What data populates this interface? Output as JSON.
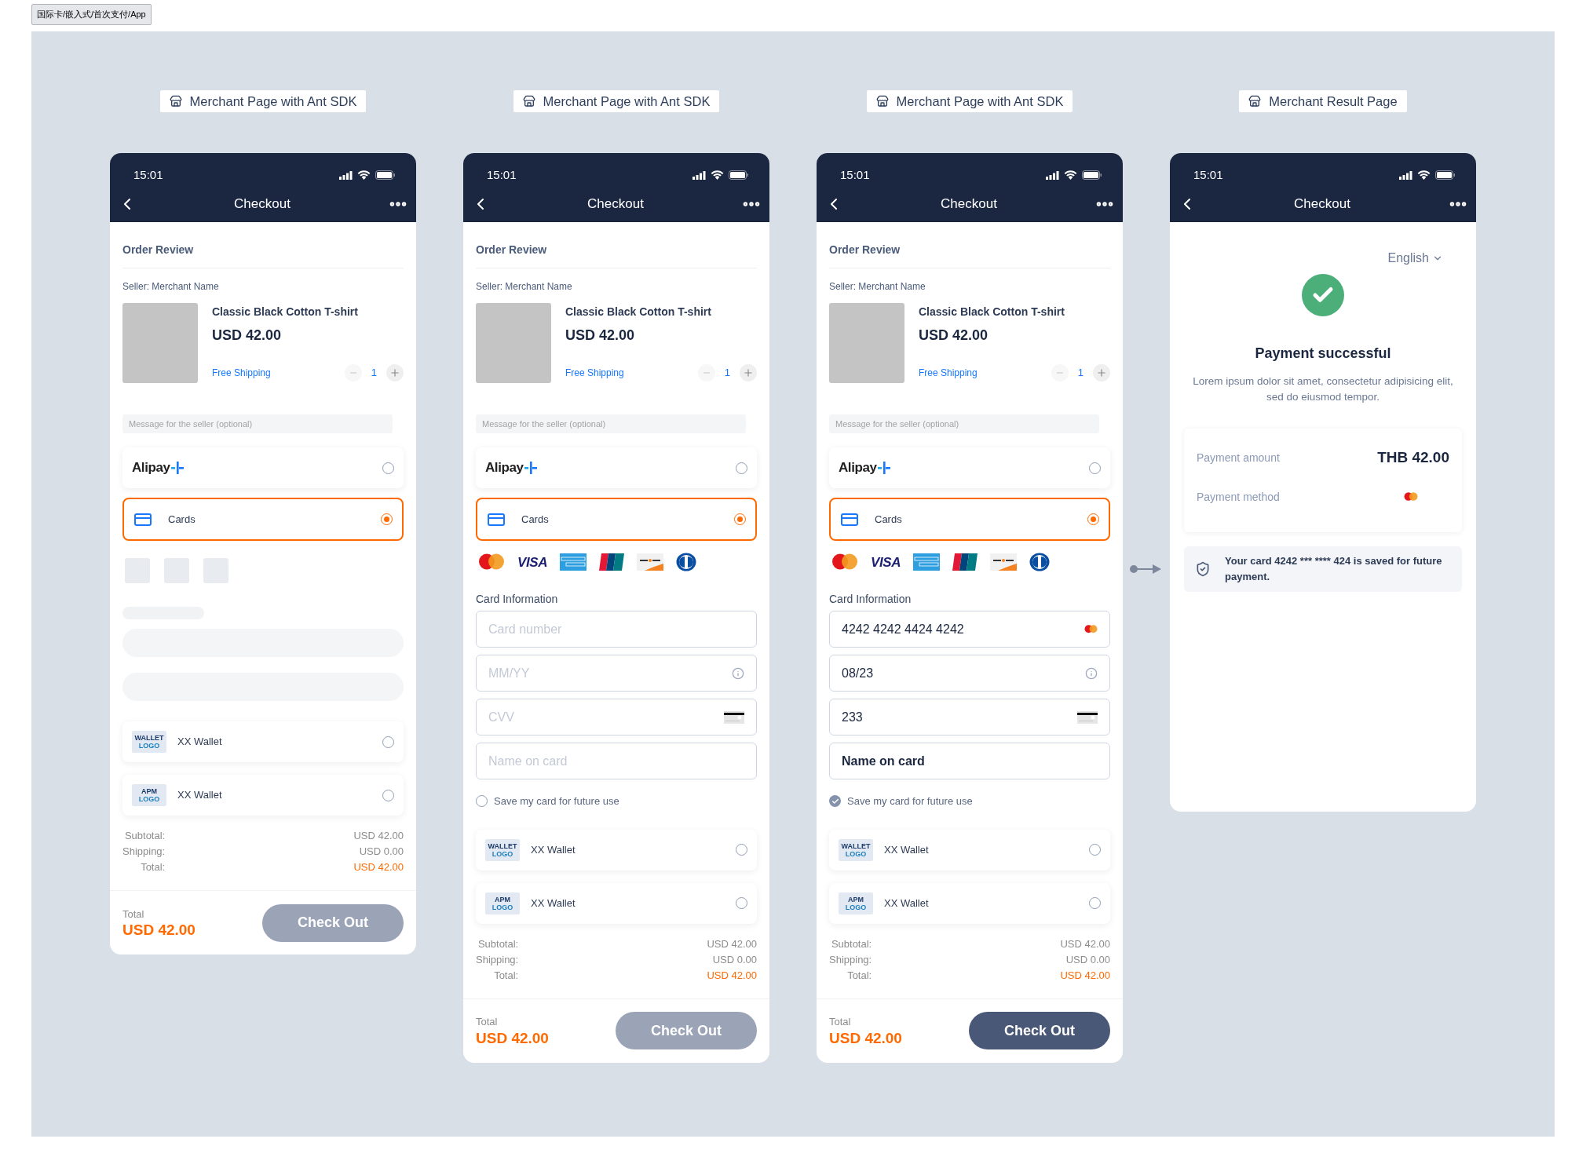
{
  "breadcrumb": "国际卡/嵌入式/首次支付/App",
  "screens": [
    {
      "kind": "checkout",
      "caption": "Merchant Page with Ant SDK",
      "time": "15:01",
      "nav_title": "Checkout",
      "section_title": "Order Review",
      "seller": "Seller: Merchant Name",
      "product": {
        "title": "Classic Black Cotton T-shirt",
        "price": "USD 42.00",
        "shipping": "Free Shipping",
        "quantity": "1"
      },
      "message_placeholder": "Message for the seller (optional)",
      "methods": [
        {
          "kind": "alipay",
          "label": "Alipay",
          "selected": false
        },
        {
          "kind": "cards",
          "label": "Cards",
          "selected": true
        }
      ],
      "card_section": {
        "kind": "skeleton"
      },
      "wallets": [
        {
          "logo_lines": [
            "WALLET",
            "LOGO"
          ],
          "label": "XX Wallet",
          "selected": false
        },
        {
          "logo_lines": [
            "APM",
            "LOGO"
          ],
          "label": "XX Wallet",
          "selected": false
        }
      ],
      "summary": [
        {
          "label": "Subtotal:",
          "value": "USD 42.00",
          "highlight": false
        },
        {
          "label": "Shipping:",
          "value": "USD 0.00",
          "highlight": false
        },
        {
          "label": "Total:",
          "value": "USD 42.00",
          "highlight": true
        }
      ],
      "footer": {
        "label": "Total",
        "amount": "USD 42.00",
        "button": {
          "label": "Check Out",
          "disabled": true
        }
      }
    },
    {
      "kind": "checkout",
      "caption": "Merchant Page with Ant SDK",
      "time": "15:01",
      "nav_title": "Checkout",
      "section_title": "Order Review",
      "seller": "Seller: Merchant Name",
      "product": {
        "title": "Classic Black Cotton T-shirt",
        "price": "USD 42.00",
        "shipping": "Free Shipping",
        "quantity": "1"
      },
      "message_placeholder": "Message for the seller (optional)",
      "methods": [
        {
          "kind": "alipay",
          "label": "Alipay",
          "selected": false
        },
        {
          "kind": "cards",
          "label": "Cards",
          "selected": true
        }
      ],
      "card_section": {
        "kind": "form",
        "brands": [
          {
            "kind": "mastercard"
          },
          {
            "kind": "visa",
            "label": "VISA"
          },
          {
            "kind": "amex"
          },
          {
            "kind": "unionpay"
          },
          {
            "kind": "discover"
          },
          {
            "kind": "diners"
          }
        ],
        "label": "Card Information",
        "fields": [
          {
            "kind": "number",
            "placeholder": "Card number",
            "brand_detected": false
          },
          {
            "kind": "expiry",
            "placeholder": "MM/YY"
          },
          {
            "kind": "cvv",
            "placeholder": "CVV"
          },
          {
            "kind": "name",
            "placeholder": "Name on card"
          }
        ],
        "save_card": {
          "label": "Save my card for future use",
          "checked": false
        }
      },
      "wallets": [
        {
          "logo_lines": [
            "WALLET",
            "LOGO"
          ],
          "label": "XX Wallet",
          "selected": false
        },
        {
          "logo_lines": [
            "APM",
            "LOGO"
          ],
          "label": "XX Wallet",
          "selected": false
        }
      ],
      "summary": [
        {
          "label": "Subtotal:",
          "value": "USD 42.00",
          "highlight": false
        },
        {
          "label": "Shipping:",
          "value": "USD 0.00",
          "highlight": false
        },
        {
          "label": "Total:",
          "value": "USD 42.00",
          "highlight": true
        }
      ],
      "footer": {
        "label": "Total",
        "amount": "USD 42.00",
        "button": {
          "label": "Check Out",
          "disabled": true
        }
      }
    },
    {
      "kind": "checkout",
      "caption": "Merchant Page with Ant SDK",
      "time": "15:01",
      "nav_title": "Checkout",
      "section_title": "Order Review",
      "seller": "Seller: Merchant Name",
      "product": {
        "title": "Classic Black Cotton T-shirt",
        "price": "USD 42.00",
        "shipping": "Free Shipping",
        "quantity": "1"
      },
      "message_placeholder": "Message for the seller (optional)",
      "methods": [
        {
          "kind": "alipay",
          "label": "Alipay",
          "selected": false
        },
        {
          "kind": "cards",
          "label": "Cards",
          "selected": true
        }
      ],
      "card_section": {
        "kind": "form",
        "brands": [
          {
            "kind": "mastercard"
          },
          {
            "kind": "visa",
            "label": "VISA"
          },
          {
            "kind": "amex"
          },
          {
            "kind": "unionpay"
          },
          {
            "kind": "discover"
          },
          {
            "kind": "diners"
          }
        ],
        "label": "Card Information",
        "fields": [
          {
            "kind": "number",
            "value": "4242 4242 4424 4242",
            "brand_detected": true
          },
          {
            "kind": "expiry",
            "value": "08/23"
          },
          {
            "kind": "cvv",
            "value": "233"
          },
          {
            "kind": "name",
            "value": "Name on card"
          }
        ],
        "save_card": {
          "label": "Save my card for future use",
          "checked": true
        }
      },
      "wallets": [
        {
          "logo_lines": [
            "WALLET",
            "LOGO"
          ],
          "label": "XX Wallet",
          "selected": false
        },
        {
          "logo_lines": [
            "APM",
            "LOGO"
          ],
          "label": "XX Wallet",
          "selected": false
        }
      ],
      "summary": [
        {
          "label": "Subtotal:",
          "value": "USD 42.00",
          "highlight": false
        },
        {
          "label": "Shipping:",
          "value": "USD 0.00",
          "highlight": false
        },
        {
          "label": "Total:",
          "value": "USD 42.00",
          "highlight": true
        }
      ],
      "footer": {
        "label": "Total",
        "amount": "USD 42.00",
        "button": {
          "label": "Check Out",
          "disabled": false
        }
      }
    },
    {
      "kind": "result",
      "caption": "Merchant Result Page",
      "time": "15:01",
      "nav_title": "Checkout",
      "language": "English",
      "title": "Payment successful",
      "message": "Lorem ipsum dolor sit amet, consectetur adipisicing elit, sed do eiusmod tempor.",
      "details": [
        {
          "kind": "text",
          "label": "Payment amount",
          "value": "THB 42.00"
        },
        {
          "kind": "card_brand",
          "label": "Payment method"
        }
      ],
      "notice": "Your card 4242 *** **** 424 is saved for future payment."
    }
  ]
}
